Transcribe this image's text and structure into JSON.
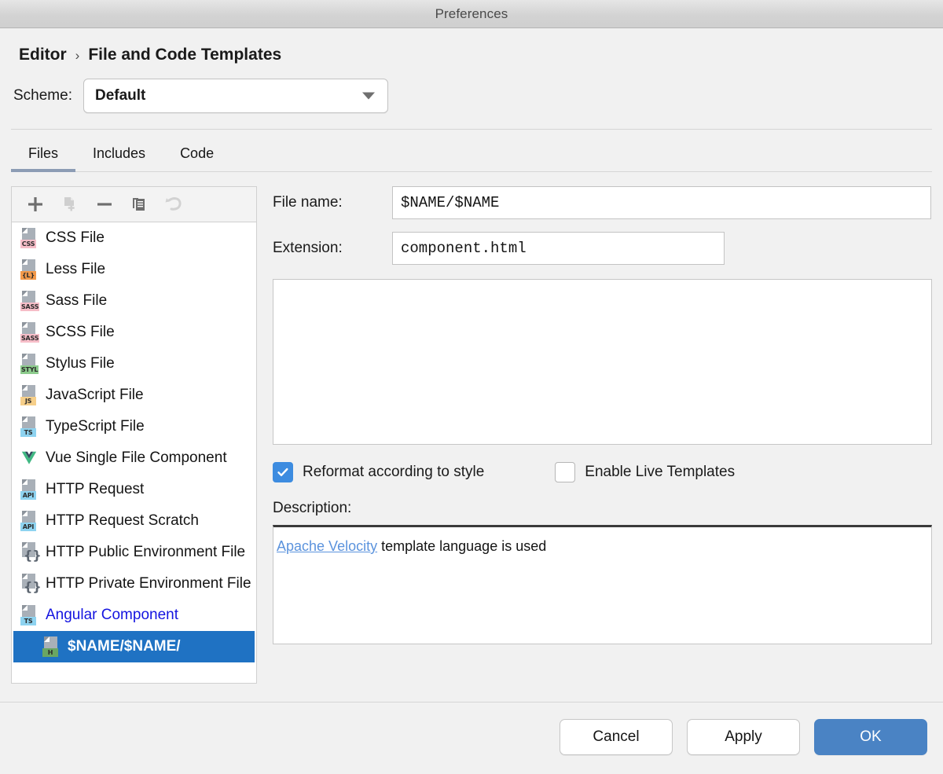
{
  "window": {
    "title": "Preferences"
  },
  "breadcrumb": {
    "root": "Editor",
    "separator": "›",
    "current": "File and Code Templates"
  },
  "scheme": {
    "label": "Scheme:",
    "value": "Default",
    "icon": "chevron-down-icon"
  },
  "tabs": [
    {
      "label": "Files",
      "active": true
    },
    {
      "label": "Includes",
      "active": false
    },
    {
      "label": "Code",
      "active": false
    }
  ],
  "list_toolbar": [
    {
      "name": "add-button",
      "icon": "plus-icon",
      "enabled": true
    },
    {
      "name": "add-child-template-button",
      "icon": "add-file-icon",
      "enabled": false
    },
    {
      "name": "remove-button",
      "icon": "minus-icon",
      "enabled": true
    },
    {
      "name": "copy-button",
      "icon": "copy-icon",
      "enabled": true
    },
    {
      "name": "reset-button",
      "icon": "undo-arrow-icon",
      "enabled": false
    }
  ],
  "file_list": [
    {
      "label": "CSS File",
      "icon": "css-file-icon",
      "badge": "CSS",
      "badge_bg": "#f6bdc8",
      "selected": false,
      "link": false,
      "indent": false
    },
    {
      "label": "Less File",
      "icon": "less-file-icon",
      "badge": "{L}",
      "badge_bg": "#f2994a",
      "selected": false,
      "link": false,
      "indent": false
    },
    {
      "label": "Sass File",
      "icon": "sass-file-icon",
      "badge": "SASS",
      "badge_bg": "#f6bdc8",
      "selected": false,
      "link": false,
      "indent": false
    },
    {
      "label": "SCSS File",
      "icon": "scss-file-icon",
      "badge": "SASS",
      "badge_bg": "#f6bdc8",
      "selected": false,
      "link": false,
      "indent": false
    },
    {
      "label": "Stylus File",
      "icon": "stylus-file-icon",
      "badge": "STYL",
      "badge_bg": "#8ccb8c",
      "selected": false,
      "link": false,
      "indent": false
    },
    {
      "label": "JavaScript File",
      "icon": "javascript-file-icon",
      "badge": "JS",
      "badge_bg": "#f6cf8a",
      "selected": false,
      "link": false,
      "indent": false
    },
    {
      "label": "TypeScript File",
      "icon": "typescript-file-icon",
      "badge": "TS",
      "badge_bg": "#8ed3f0",
      "selected": false,
      "link": false,
      "indent": false
    },
    {
      "label": "Vue Single File Component",
      "icon": "vue-file-icon",
      "badge": "",
      "badge_bg": "",
      "selected": false,
      "link": false,
      "indent": false
    },
    {
      "label": "HTTP Request",
      "icon": "http-request-icon",
      "badge": "API",
      "badge_bg": "#8ed3f0",
      "selected": false,
      "link": false,
      "indent": false
    },
    {
      "label": "HTTP Request Scratch",
      "icon": "http-scratch-icon",
      "badge": "API",
      "badge_bg": "#8ed3f0",
      "selected": false,
      "link": false,
      "indent": false
    },
    {
      "label": "HTTP Public Environment File",
      "icon": "http-public-env-icon",
      "badge": "{}",
      "badge_bg": "",
      "selected": false,
      "link": false,
      "indent": false
    },
    {
      "label": "HTTP Private Environment File",
      "icon": "http-private-env-icon",
      "badge": "{}",
      "badge_bg": "",
      "selected": false,
      "link": false,
      "indent": false
    },
    {
      "label": "Angular Component",
      "icon": "angular-component-icon",
      "badge": "TS",
      "badge_bg": "#8ed3f0",
      "selected": false,
      "link": true,
      "indent": false
    },
    {
      "label": "$NAME/$NAME/",
      "icon": "html-file-icon",
      "badge": "H",
      "badge_bg": "#6aa663",
      "selected": true,
      "link": false,
      "indent": true
    }
  ],
  "form": {
    "file_name_label": "File name:",
    "file_name_value": "$NAME/$NAME",
    "extension_label": "Extension:",
    "extension_value": "component.html",
    "template_body": ""
  },
  "options": {
    "reformat": {
      "label": "Reformat according to style",
      "checked": true,
      "icon": "checkmark-icon"
    },
    "live_templates": {
      "label": "Enable Live Templates",
      "checked": false
    }
  },
  "description": {
    "label": "Description:",
    "link_text": "Apache Velocity",
    "rest_text": " template language is used"
  },
  "footer": {
    "cancel": "Cancel",
    "apply": "Apply",
    "ok": "OK"
  },
  "colors": {
    "selection_blue": "#1f72c3",
    "primary_button": "#4a83c4",
    "checkbox_blue": "#3d8ce0",
    "link_blue": "#5b93dd",
    "list_link_blue": "#1414e0",
    "tab_underline": "#8c9cb4"
  }
}
